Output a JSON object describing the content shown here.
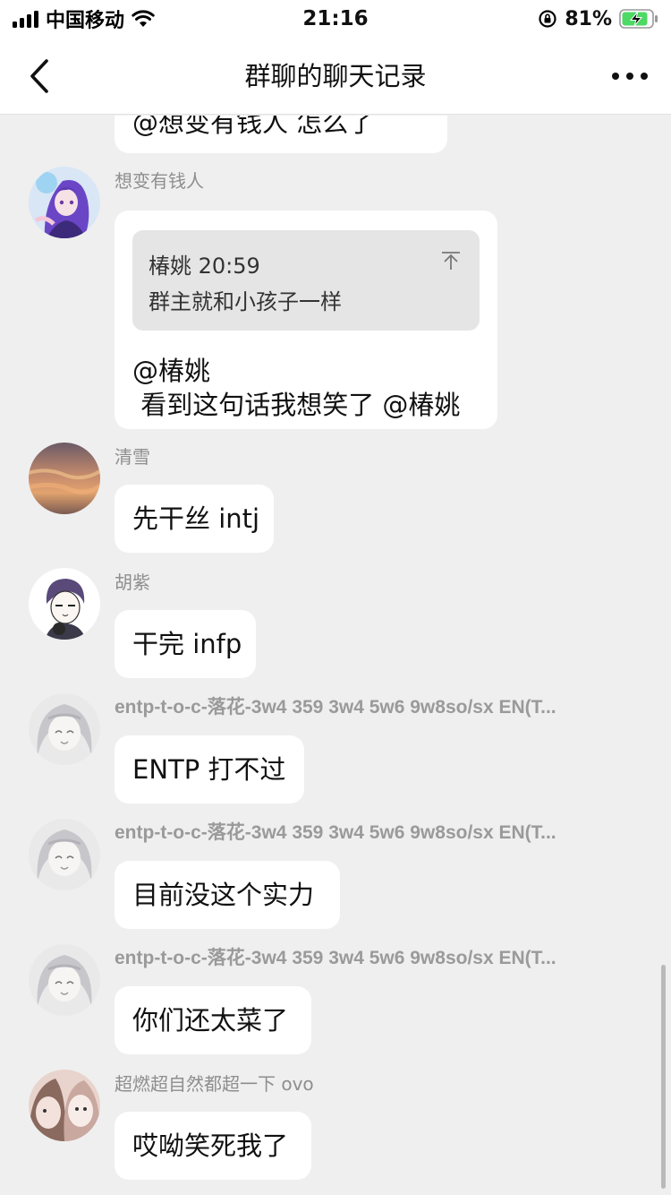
{
  "status_bar": {
    "carrier": "中国移动",
    "time": "21:16",
    "battery_percent": "81%"
  },
  "nav": {
    "title": "群聊的聊天记录"
  },
  "messages": [
    {
      "text": "@想变有钱人 怎么了"
    },
    {
      "sender": "想变有钱人",
      "quote": {
        "author_time": "椿姚 20:59",
        "text": "群主就和小孩子一样"
      },
      "line1": "@椿姚",
      "line2": " 看到这句话我想笑了 @椿姚"
    },
    {
      "sender": "清雪",
      "text": "先干丝 intj"
    },
    {
      "sender": "胡紫",
      "text": "干完 infp"
    },
    {
      "sender": "entp-t-o-c-落花-3w4 359 3w4 5w6 9w8so/sx EN(T...",
      "text": "ENTP 打不过"
    },
    {
      "sender": "entp-t-o-c-落花-3w4 359 3w4 5w6 9w8so/sx EN(T...",
      "text": "目前没这个实力"
    },
    {
      "sender": "entp-t-o-c-落花-3w4 359 3w4 5w6 9w8so/sx EN(T...",
      "text": "你们还太菜了"
    },
    {
      "sender": "超燃超自然都超一下 ovo",
      "text": "哎呦笑死我了"
    }
  ],
  "icons": {
    "back": "chevron-left-icon",
    "more": "more-dots-icon",
    "quote_pin": "pin-to-top-icon"
  }
}
